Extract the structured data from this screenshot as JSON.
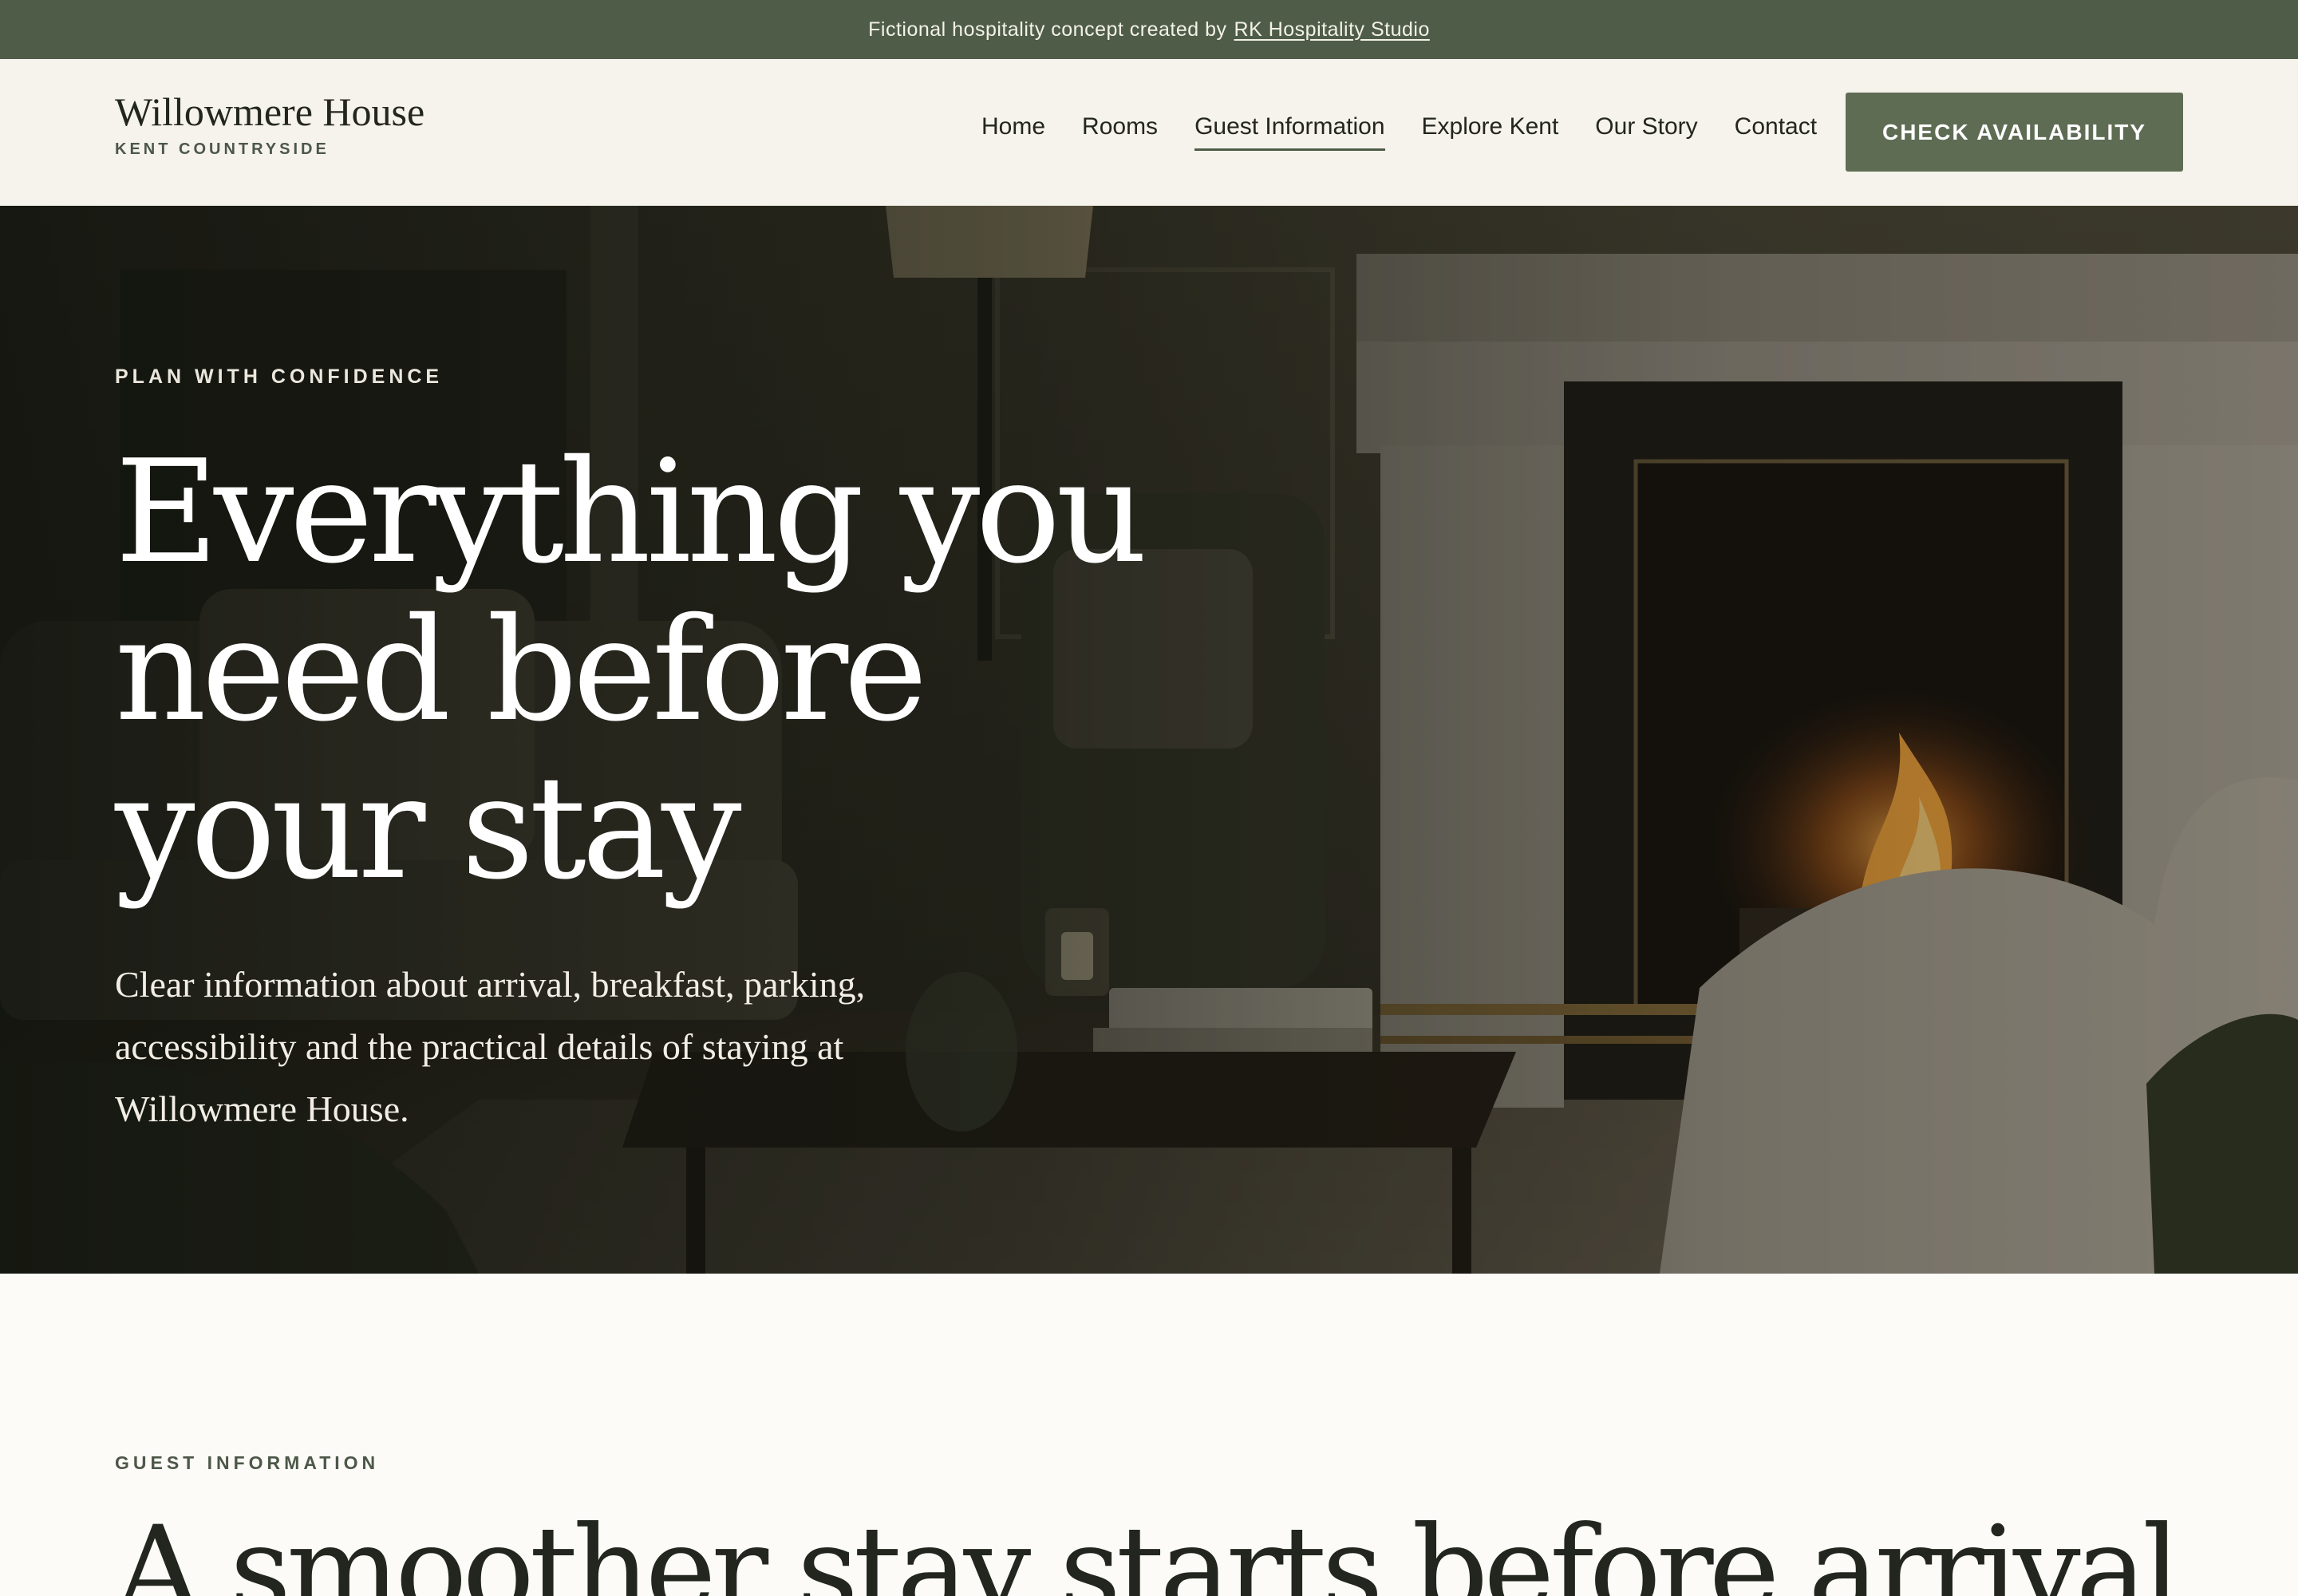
{
  "banner": {
    "text": "Fictional hospitality concept created by",
    "link_label": "RK Hospitality Studio"
  },
  "brand": {
    "name": "Willowmere House",
    "tagline": "KENT COUNTRYSIDE"
  },
  "nav": {
    "items": [
      {
        "label": "Home",
        "active": false
      },
      {
        "label": "Rooms",
        "active": false
      },
      {
        "label": "Guest Information",
        "active": true
      },
      {
        "label": "Explore Kent",
        "active": false
      },
      {
        "label": "Our Story",
        "active": false
      },
      {
        "label": "Contact",
        "active": false
      }
    ],
    "cta_label": "CHECK AVAILABILITY"
  },
  "hero": {
    "eyebrow": "PLAN WITH CONFIDENCE",
    "title": "Everything you need before your stay",
    "description": "Clear information about arrival, breakfast, parking, accessibility and the practical details of staying at Willowmere House.",
    "image": "cozy sitting room with lit fireplace, armchairs and coffee table"
  },
  "section": {
    "eyebrow": "GUEST INFORMATION",
    "title": "A smoother stay starts before arrival"
  },
  "colors": {
    "banner_bg": "#4f5d48",
    "header_bg": "#f5f3ec",
    "accent": "#5f6c54",
    "page_bg": "#fcfbf7",
    "text_dark": "#23261f"
  }
}
